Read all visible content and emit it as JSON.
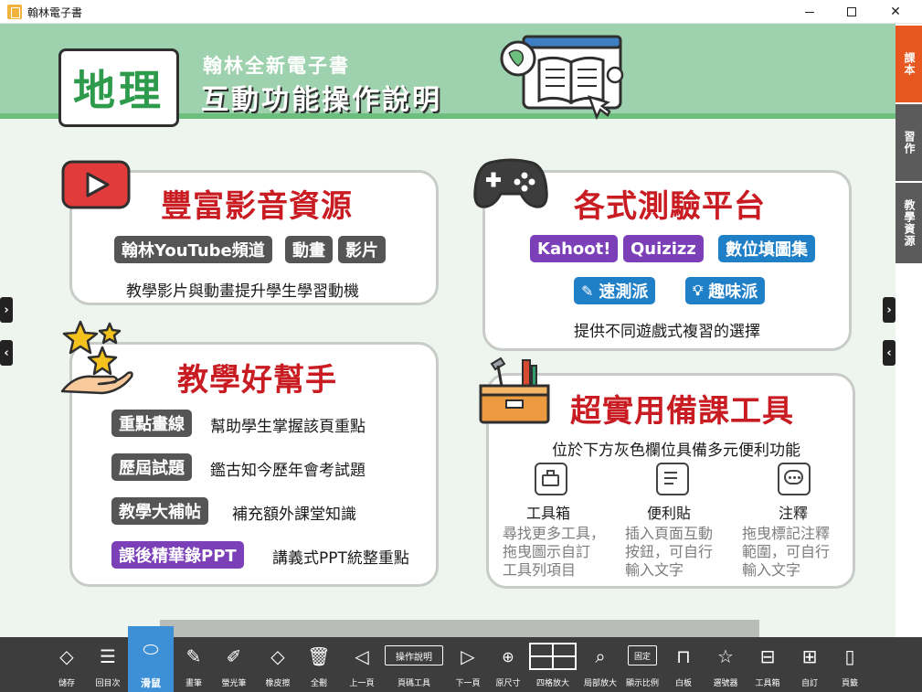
{
  "window": {
    "title": "翰林電子書"
  },
  "header": {
    "subject": "地理",
    "line1": "翰林全新電子書",
    "line2": "互動功能操作說明"
  },
  "cards": {
    "media": {
      "title": "豐富影音資源",
      "pills": [
        "翰林YouTube頻道",
        "動畫",
        "影片"
      ],
      "desc": "教學影片與動畫提升學生學習動機"
    },
    "quiz": {
      "title": "各式測驗平台",
      "pills": [
        "Kahoot!",
        "Quizizz",
        "數位填圖集",
        "速測派",
        "趣味派"
      ],
      "desc": "提供不同遊戲式複習的選擇"
    },
    "helper": {
      "title": "教學好幫手",
      "rows": [
        {
          "tag": "重點畫線",
          "text": "幫助學生掌握該頁重點"
        },
        {
          "tag": "歷屆試題",
          "text": "鑑古知今歷年會考試題"
        },
        {
          "tag": "教學大補帖",
          "text": "補充額外課堂知識"
        },
        {
          "tag": "課後精華錄PPT",
          "text": "講義式PPT統整重點"
        }
      ]
    },
    "tools": {
      "title": "超實用備課工具",
      "desc": "位於下方灰色欄位具備多元便利功能",
      "items": [
        {
          "name": "工具箱",
          "lines": [
            "尋找更多工具，",
            "拖曳圖示自訂",
            "工具列項目"
          ]
        },
        {
          "name": "便利貼",
          "lines": [
            "插入頁面互動",
            "按鈕，可自行",
            "輸入文字"
          ]
        },
        {
          "name": "注釋",
          "lines": [
            "拖曳標記注釋",
            "範圍，可自行",
            "輸入文字"
          ]
        }
      ]
    }
  },
  "right_tabs": [
    {
      "label": "課本",
      "color": "#e8571f"
    },
    {
      "label": "習作",
      "color": "#5b5b5b"
    },
    {
      "label": "教學資源",
      "color": "#5b5b5b"
    }
  ],
  "toolbar": {
    "items": [
      {
        "label": "儲存",
        "icon": "eraser-save-icon"
      },
      {
        "label": "回目次",
        "icon": "list-icon"
      },
      {
        "label": "滑鼠",
        "icon": "mouse-icon",
        "active": true
      },
      {
        "label": "畫筆",
        "icon": "pen-icon"
      },
      {
        "label": "螢光筆",
        "icon": "highlighter-icon"
      },
      {
        "label": "橡皮擦",
        "icon": "eraser-icon"
      },
      {
        "label": "全刪",
        "icon": "trash-icon"
      },
      {
        "label": "上一頁",
        "icon": "prev-icon"
      },
      {
        "label": "頁碼工具",
        "icon": "page-tool-icon",
        "box": "操作說明"
      },
      {
        "label": "下一頁",
        "icon": "next-icon"
      },
      {
        "label": "原尺寸",
        "icon": "original-size-icon"
      },
      {
        "label": "四格放大",
        "icon": "four-grid-icon"
      },
      {
        "label": "局部放大",
        "icon": "zoom-area-icon"
      },
      {
        "label": "顯示比例",
        "icon": "display-ratio-icon",
        "box": "固定"
      },
      {
        "label": "白板",
        "icon": "whiteboard-icon"
      },
      {
        "label": "選號器",
        "icon": "picker-icon"
      },
      {
        "label": "工具箱",
        "icon": "toolbox-icon"
      },
      {
        "label": "自訂",
        "icon": "custom-icon"
      },
      {
        "label": "頁籤",
        "icon": "bookmark-icon"
      }
    ]
  }
}
